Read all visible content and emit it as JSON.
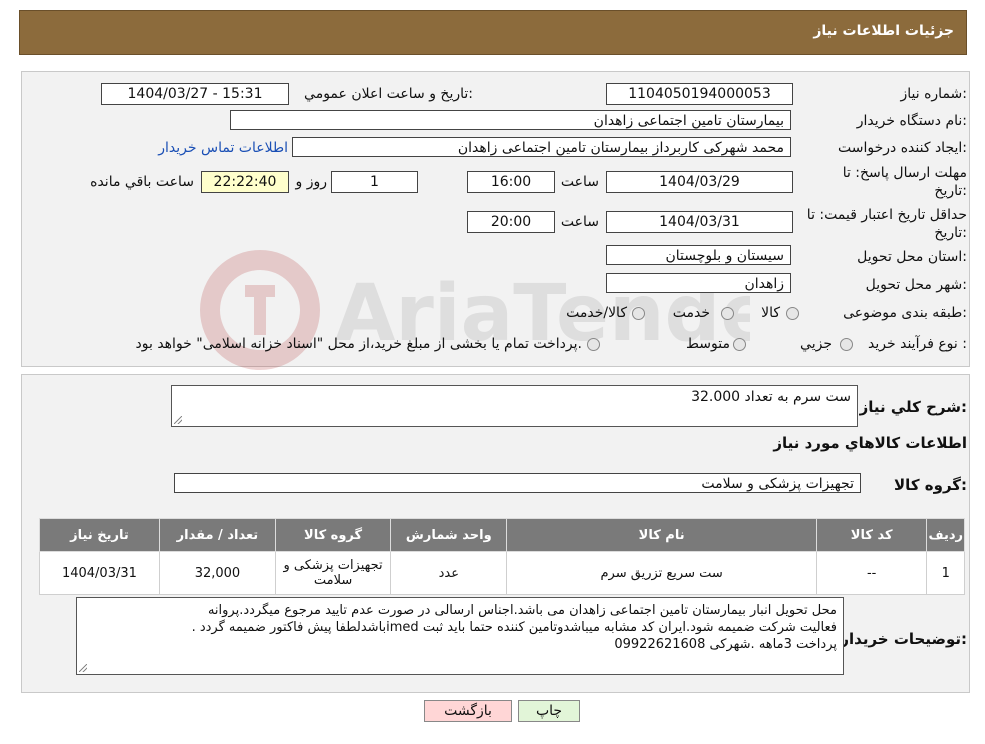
{
  "header": {
    "title": "جزئیات اطلاعات نیاز"
  },
  "form": {
    "need_number": {
      "label": "شماره نیاز:",
      "value": "1104050194000053"
    },
    "announce_datetime": {
      "label": "تاریخ و ساعت اعلان عمومي:",
      "value": "1404/03/27 - 15:31"
    },
    "buyer_org": {
      "label": "نام دستگاه خريدار:",
      "value": "بیمارستان تامین اجتماعی زاهدان"
    },
    "requester": {
      "label": "ايجاد کننده درخواست:",
      "value": "محمد شهرکی کاربرداز بیمارستان تامین اجتماعی زاهدان"
    },
    "contact_link": "اطلاعات تماس خريدار",
    "deadline": {
      "label_line1": "مهلت ارسال پاسخ: تا",
      "label_line2": "تاریخ:",
      "date": "1404/03/29",
      "time_label": "ساعت",
      "time": "16:00",
      "days": "1",
      "days_label": "روز و",
      "remaining": "22:22:40",
      "remaining_label": "ساعت باقي مانده"
    },
    "price_validity": {
      "label_line1": "حداقل تاريخ اعتبار قيمت: تا",
      "label_line2": "تاريخ:",
      "date": "1404/03/31",
      "time_label": "ساعت",
      "time": "20:00"
    },
    "province": {
      "label": "استان محل تحويل:",
      "value": "سیستان و بلوچستان"
    },
    "city": {
      "label": "شهر محل تحويل:",
      "value": "زاهدان"
    },
    "category": {
      "label": "طبقه بندی موضوعی:",
      "options": [
        "کالا",
        "خدمت",
        "کالا/خدمت"
      ]
    },
    "process": {
      "label": "نوع فرآيند خريد :",
      "options": [
        "جزيي",
        "متوسط"
      ],
      "note": "پرداخت تمام يا بخشی از مبلغ خريد،از محل \"اسناد خزانه اسلامی\" خواهد بود."
    }
  },
  "summary": {
    "label": "شرح کلي نياز:",
    "value": "ست سرم به تعداد 32.000",
    "goods_info_title": "اطلاعات کالاهاي مورد نياز",
    "goods_group_label": "گروه کالا:",
    "goods_group_value": "تجهیزات پزشکی و سلامت"
  },
  "table": {
    "headers": [
      "رديف",
      "کد کالا",
      "نام کالا",
      "واحد شمارش",
      "گروه کالا",
      "تعداد / مقدار",
      "تاريخ نياز"
    ],
    "rows": [
      [
        "1",
        "--",
        "ست سریع تزریق سرم",
        "عدد",
        "تجهیزات پزشکی و سلامت",
        "32,000",
        "1404/03/31"
      ]
    ]
  },
  "buyer_notes": {
    "label": "توضيحات خريدار:",
    "line1": "محل تحویل انبار بیمارستان تامین اجتماعی زاهدان می باشد.اجناس ارسالی در صورت عدم تایید مرجوع میگردد.پروانه",
    "line2": "فعالیت شرکت ضمیمه شود.ایران کد مشابه میباشدوتامین کننده حتما باید ثبت imedباشدلطفا پیش فاکتور ضمیمه گردد .",
    "line3": "پرداخت 3ماهه  .شهرکی 09922621608"
  },
  "buttons": {
    "print": "چاپ",
    "back": "بازگشت"
  },
  "colors": {
    "header_bg": "#8c6b3c",
    "panel_bg": "#f2f2f2",
    "table_header_bg": "#7a7a7a",
    "back_btn_bg": "#ffd6d6",
    "print_btn_bg": "#e2f5d8"
  }
}
